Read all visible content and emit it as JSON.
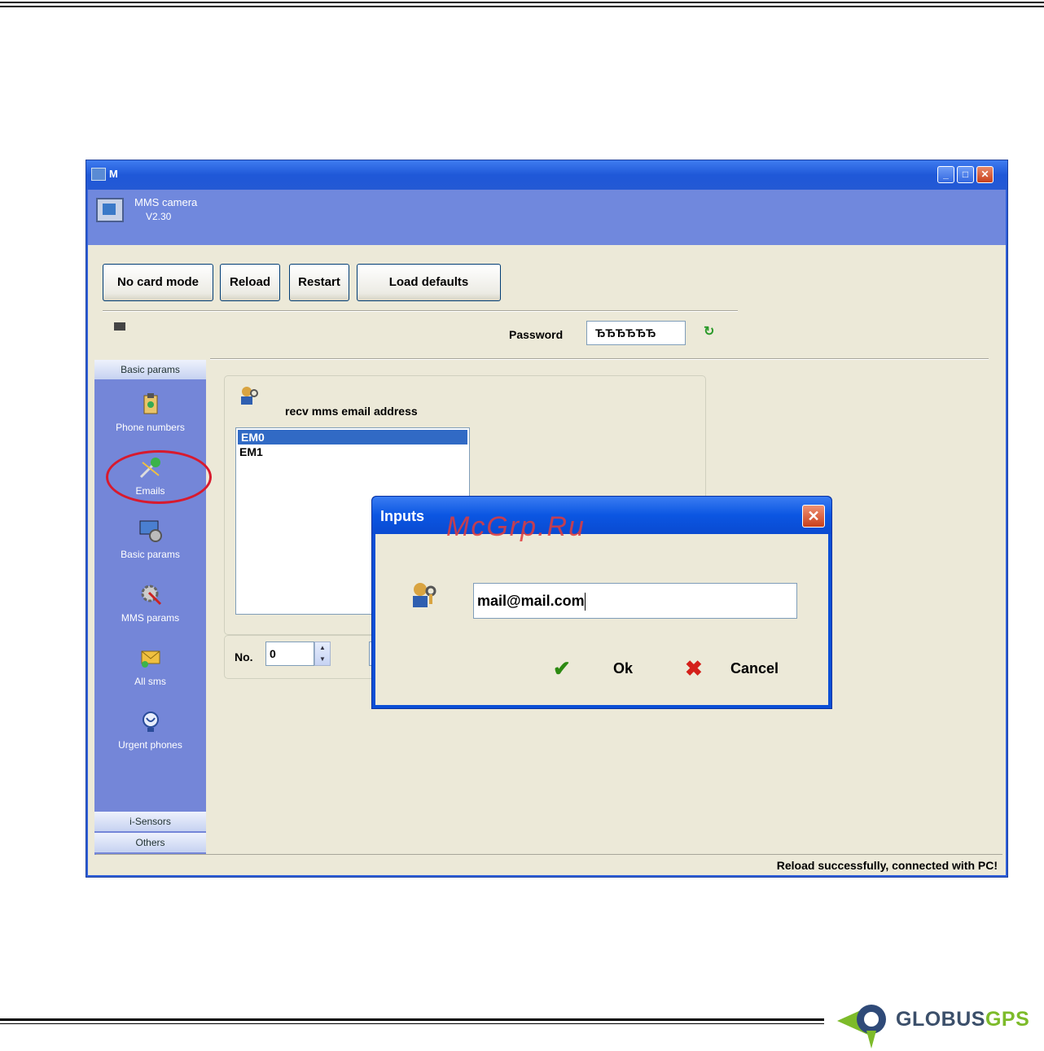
{
  "window": {
    "title": "M",
    "controls": {
      "minimize": "_",
      "maximize": "□",
      "close": "✕"
    },
    "app_name": "MMS camera",
    "app_version": "V2.30"
  },
  "toolbar": {
    "no_card_mode": "No card mode",
    "reload": "Reload",
    "restart": "Restart",
    "load_defaults": "Load defaults"
  },
  "password": {
    "label": "Password",
    "value": "ЂЂЂЂЂЂ"
  },
  "sidebar": {
    "header_basic": "Basic params",
    "items": [
      {
        "label": "Phone numbers",
        "icon": "clipboard-icon"
      },
      {
        "label": "Emails",
        "icon": "pushpin-icon"
      },
      {
        "label": "Basic params",
        "icon": "monitor-gear-icon"
      },
      {
        "label": "MMS params",
        "icon": "gear-pen-icon"
      },
      {
        "label": "All sms",
        "icon": "envelope-icon"
      },
      {
        "label": "Urgent phones",
        "icon": "phone-icon"
      }
    ],
    "header_isensors": "i-Sensors",
    "header_others": "Others"
  },
  "emails": {
    "group_label": "recv mms email address",
    "list": [
      "EM0",
      "EM1"
    ],
    "selected_index": 0,
    "no_label": "No.",
    "no_value": "0"
  },
  "status": {
    "text": "Reload successfully, connected with PC!"
  },
  "dialog": {
    "title": "Inputs",
    "close": "✕",
    "input_value": "mail@mail.com",
    "ok_label": "Ok",
    "cancel_label": "Cancel"
  },
  "watermark": "McGrp.Ru",
  "logo": {
    "part1": "GLOBUS",
    "part2": "GPS"
  },
  "colors": {
    "selection": "#316ac5",
    "accent_green": "#7dbb2a",
    "circle_red": "#d81a2e"
  }
}
